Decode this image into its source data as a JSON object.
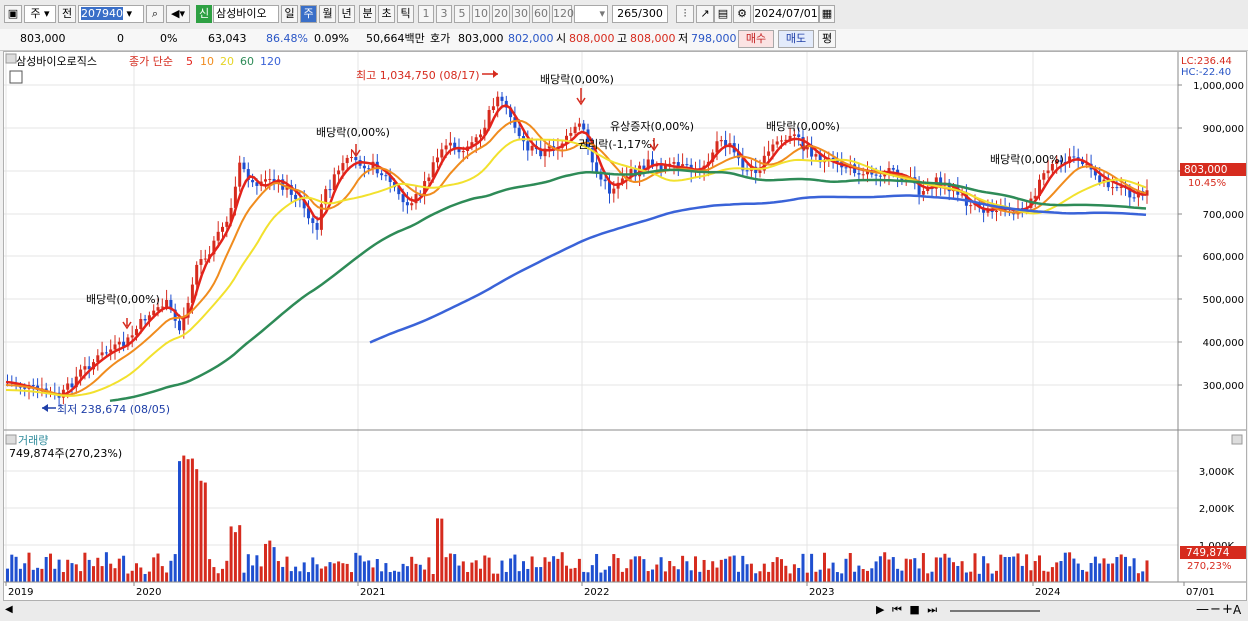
{
  "toolbar": {
    "type_label": "주",
    "prev_label": "전",
    "code": "207940",
    "name": "삼성바이오",
    "periods": [
      "일",
      "주",
      "월",
      "년",
      "분",
      "초",
      "틱"
    ],
    "minutes": [
      "1",
      "3",
      "5",
      "10",
      "20",
      "30",
      "60",
      "120"
    ],
    "count": "265",
    "count_total": "/300",
    "date": "2024/07/01",
    "new_badge": "신"
  },
  "info": {
    "price": "803,000",
    "change": "0",
    "change_pct": "0%",
    "volume": "63,043",
    "vol_ratio": "86.48%",
    "turnover": "0.09%",
    "amount": "50,664백만",
    "quote_label": "호가",
    "ask": "803,000",
    "bid": "802,000",
    "open_label": "시",
    "open": "808,000",
    "high_label": "고",
    "high": "808,000",
    "low_label": "저",
    "low": "798,000",
    "buy": "매수",
    "sell": "매도",
    "eval": "평"
  },
  "price_panel": {
    "title": "삼성바이오로직스",
    "ma_label": "종가 단순",
    "ma_periods": [
      "5",
      "10",
      "20",
      "60",
      "120"
    ],
    "lc": "LC:236.44",
    "hc": "HC:-22.40",
    "current_price": "803,000",
    "current_pct": "10.45%",
    "y_ticks": [
      "1,000,000",
      "900,000",
      "800,000",
      "700,000",
      "600,000",
      "500,000",
      "400,000",
      "300,000"
    ],
    "annotations": {
      "high": "최고 1,034,750 (08/17)",
      "low": "최저 238,674 (08/05)",
      "div1": "배당락(0,00%)",
      "div2": "배당락(0,00%)",
      "div3": "배당락(0,00%)",
      "rights": "유상증자(0,00%)",
      "rights2": "권리락(-1,17%)",
      "div4": "배당락(0,00%)",
      "div5": "배당락(0,00%)"
    }
  },
  "volume_panel": {
    "title": "거래량",
    "value": "749,874주(270,23%)",
    "y_ticks": [
      "3,000K",
      "2,000K",
      "1,000K"
    ],
    "current": "749,874",
    "current_pct": "270,23%"
  },
  "x_axis": [
    "2019",
    "2020",
    "2021",
    "2022",
    "2023",
    "2024",
    "07/01"
  ],
  "colors": {
    "up": "#d62b1e",
    "down": "#1f4fd0",
    "ma5": "#e3231b",
    "ma10": "#f08c1e",
    "ma20": "#f2e12e",
    "ma60": "#2e8b57",
    "ma120": "#3a63d8"
  }
}
